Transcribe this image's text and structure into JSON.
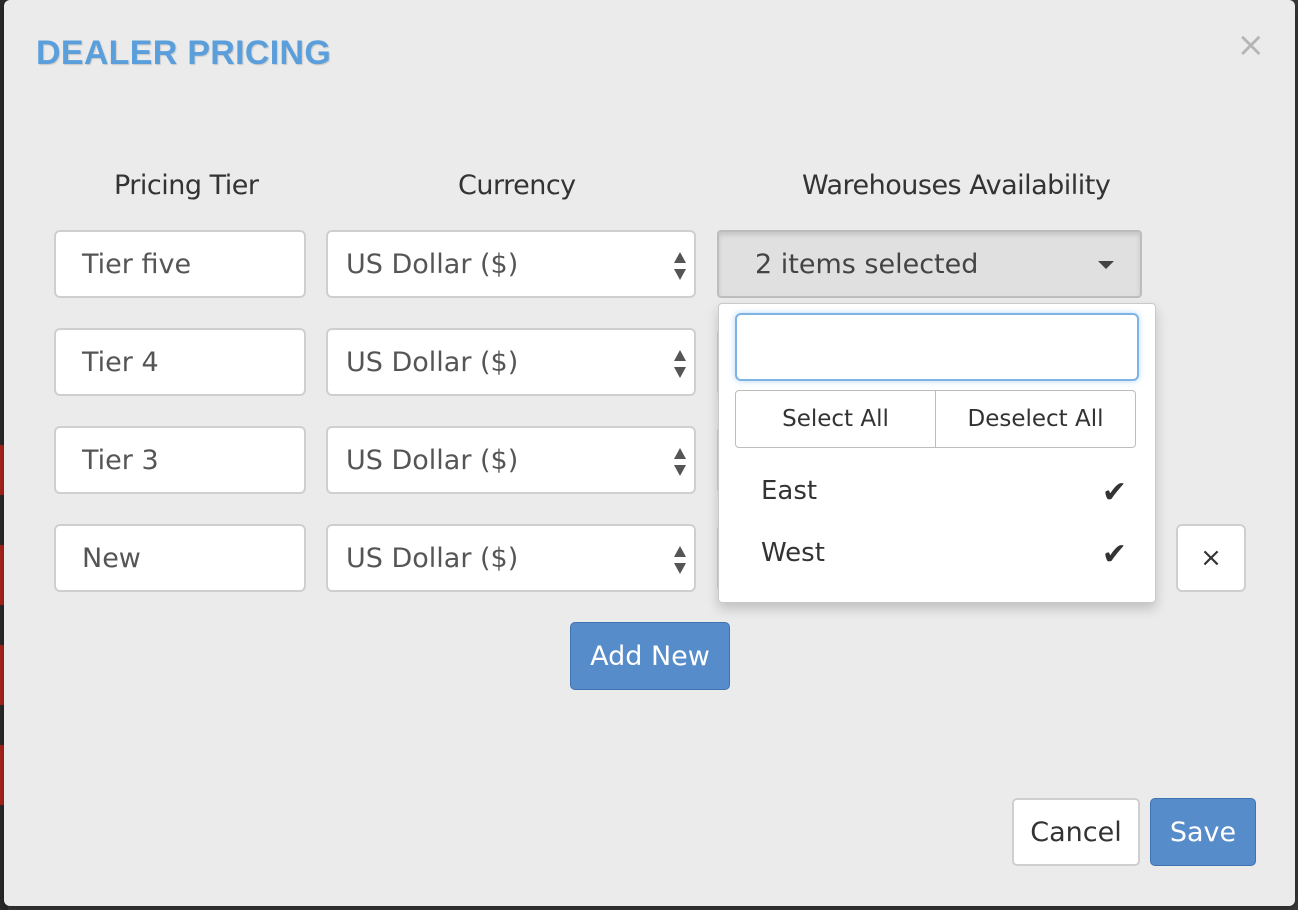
{
  "modal": {
    "title": "DEALER PRICING",
    "close_icon": "×"
  },
  "columns": {
    "pricing_tier": "Pricing Tier",
    "currency": "Currency",
    "warehouses": "Warehouses Availability"
  },
  "rows": [
    {
      "tier": "Tier five",
      "currency": "US Dollar ($)"
    },
    {
      "tier": "Tier 4",
      "currency": "US Dollar ($)"
    },
    {
      "tier": "Tier 3",
      "currency": "US Dollar ($)"
    },
    {
      "tier": "New",
      "currency": "US Dollar ($)"
    }
  ],
  "warehouse_dropdown": {
    "selected_text": "2 items selected",
    "search_value": "",
    "select_all_label": "Select All",
    "deselect_all_label": "Deselect All",
    "options": [
      {
        "label": "East",
        "checked": true,
        "check_glyph": "✔"
      },
      {
        "label": "West",
        "checked": true,
        "check_glyph": "✔"
      }
    ]
  },
  "remove_row_icon": "×",
  "buttons": {
    "add_new": "Add New",
    "cancel": "Cancel",
    "save": "Save"
  },
  "colors": {
    "title": "#5a9fdb",
    "primary": "#568cc9",
    "background": "#ebebeb"
  }
}
